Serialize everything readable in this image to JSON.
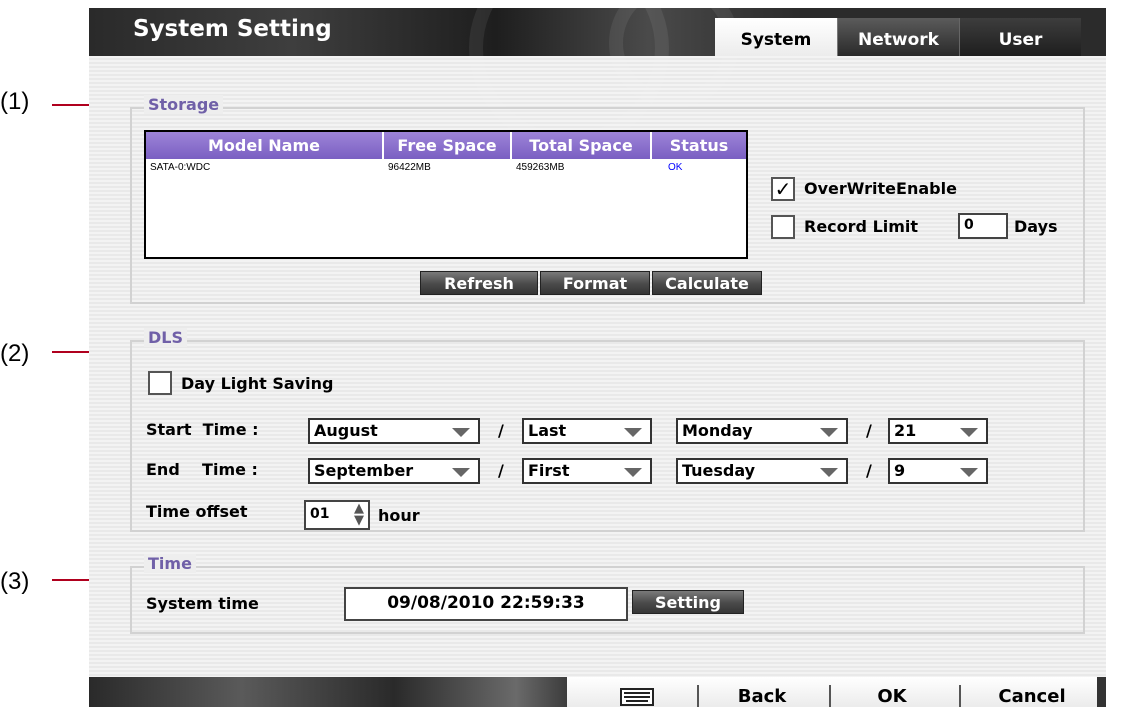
{
  "callouts": [
    "(1)",
    "(2)",
    "(3)"
  ],
  "window": {
    "title": "System Setting",
    "tabs": [
      "System",
      "Network",
      "User"
    ],
    "active_tab": "System"
  },
  "storage": {
    "legend": "Storage",
    "columns": [
      "Model Name",
      "Free Space",
      "Total Space",
      "Status"
    ],
    "rows": [
      {
        "model": "SATA-0:WDC",
        "free": "96422MB",
        "total": "459263MB",
        "status": "OK"
      }
    ],
    "buttons": [
      "Refresh",
      "Format",
      "Calculate"
    ],
    "overwrite_label": "OverWriteEnable",
    "overwrite_checked": true,
    "record_limit_label": "Record Limit",
    "record_limit_checked": false,
    "record_limit_value": "0",
    "days_label": "Days"
  },
  "dls": {
    "legend": "DLS",
    "day_light_saving_label": "Day Light Saving",
    "day_light_saving_checked": false,
    "start_label": "Start  Time :",
    "end_label": "End    Time :",
    "start": {
      "month": "August",
      "week": "Last",
      "day": "Monday",
      "date": "21"
    },
    "end": {
      "month": "September",
      "week": "First",
      "day": "Tuesday",
      "date": "9"
    },
    "separator": "/",
    "offset_label": "Time offset",
    "offset_value": "01",
    "offset_unit": "hour"
  },
  "time": {
    "legend": "Time",
    "system_time_label": "System time",
    "system_time_value": "09/08/2010 22:59:33",
    "setting_button": "Setting"
  },
  "bottom": {
    "back": "Back",
    "ok": "OK",
    "cancel": "Cancel"
  },
  "colors": {
    "accent_purple": "#7060a8",
    "table_header": "#8a70cc",
    "status_ok": "#0000ff",
    "callout_line": "#b0001e"
  }
}
